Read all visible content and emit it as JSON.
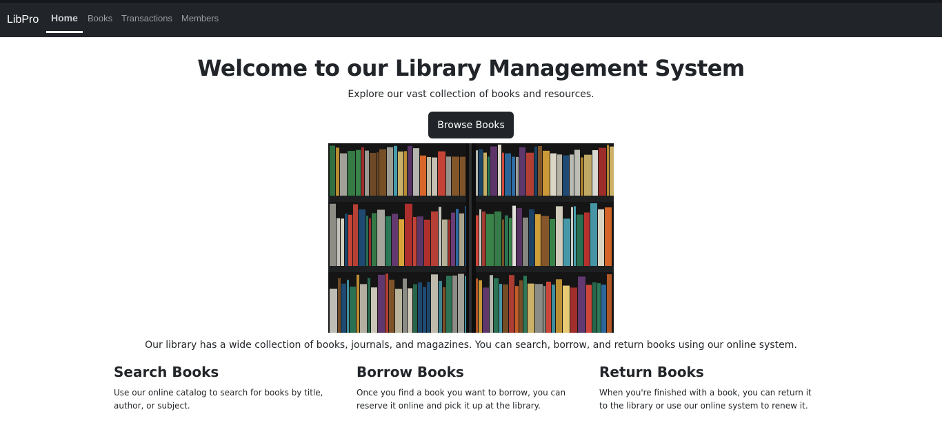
{
  "nav": {
    "brand": "LibPro",
    "links": [
      {
        "label": "Home",
        "active": true
      },
      {
        "label": "Books",
        "active": false
      },
      {
        "label": "Transactions",
        "active": false
      },
      {
        "label": "Members",
        "active": false
      }
    ]
  },
  "hero": {
    "title": "Welcome to our Library Management System",
    "subtitle": "Explore our vast collection of books and resources.",
    "button_label": "Browse Books"
  },
  "image": {
    "icon": "bookshelf-photo"
  },
  "intro": "Our library has a wide collection of books, journals, and magazines. You can search, borrow, and return books using our online system.",
  "features": [
    {
      "title": "Search Books",
      "text": "Use our online catalog to search for books by title, author, or subject."
    },
    {
      "title": "Borrow Books",
      "text": "Once you find a book you want to borrow, you can reserve it online and pick it up at the library."
    },
    {
      "title": "Return Books",
      "text": "When you're finished with a book, you can return it to the library or use our online system to renew it."
    }
  ],
  "colors": {
    "navbar": "#212529",
    "button": "#212529",
    "text": "#212529"
  }
}
